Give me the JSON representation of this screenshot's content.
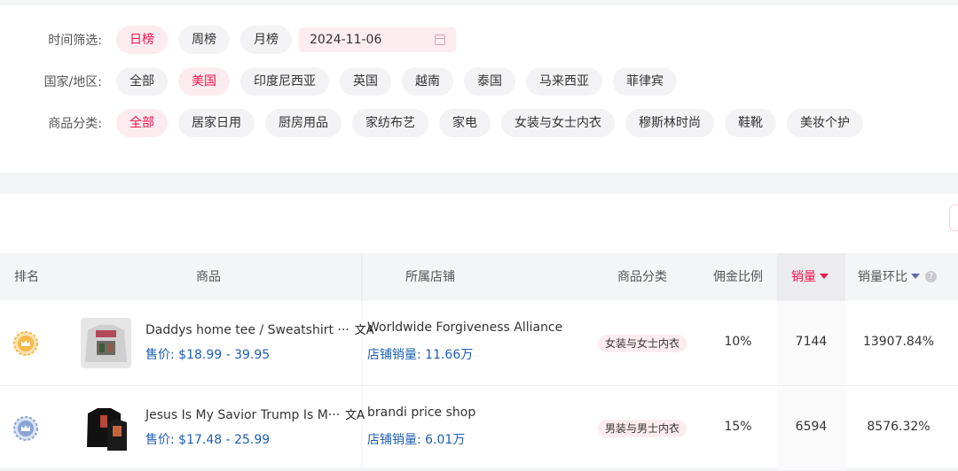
{
  "filters": {
    "time": {
      "label": "时间筛选:",
      "options": [
        "日榜",
        "周榜",
        "月榜"
      ],
      "active": "日榜",
      "date": "2024-11-06"
    },
    "region": {
      "label": "国家/地区:",
      "options": [
        "全部",
        "美国",
        "印度尼西亚",
        "英国",
        "越南",
        "泰国",
        "马来西亚",
        "菲律宾"
      ],
      "active": "美国"
    },
    "category": {
      "label": "商品分类:",
      "options": [
        "全部",
        "居家日用",
        "厨房用品",
        "家纺布艺",
        "家电",
        "女装与女士内衣",
        "穆斯林时尚",
        "鞋靴",
        "美妆个护"
      ],
      "active": "全部"
    }
  },
  "table": {
    "headers": {
      "rank": "排名",
      "product": "商品",
      "shop": "所属店铺",
      "category": "商品分类",
      "commission": "佣金比例",
      "sales": "销量",
      "sales_change": "销量环比"
    },
    "rows": [
      {
        "medal": "gold-medal-icon",
        "product_name": "Daddys home tee / Sweatshirt ···",
        "price_label": "售价:",
        "price": "$18.99 - 39.95",
        "shop": "Worldwide Forgiveness Alliance",
        "shop_sales_label": "店铺销量:",
        "shop_sales": "11.66万",
        "category": "女装与女士内衣",
        "commission": "10%",
        "sales": "7144",
        "sales_change": "13907.84%"
      },
      {
        "medal": "silver-medal-icon",
        "product_name": "Jesus Is My Savior Trump Is M···",
        "price_label": "售价:",
        "price": "$17.48 - 25.99",
        "shop": "brandi price shop",
        "shop_sales_label": "店铺销量:",
        "shop_sales": "6.01万",
        "category": "男装与男士内衣",
        "commission": "15%",
        "sales": "6594",
        "sales_change": "8576.32%"
      }
    ]
  },
  "colors": {
    "accent": "#f0144c",
    "accent_bg": "#fdecef",
    "link_blue": "#1e5fb3",
    "gold": "#f5b94a",
    "silver": "#8aa4d6"
  }
}
